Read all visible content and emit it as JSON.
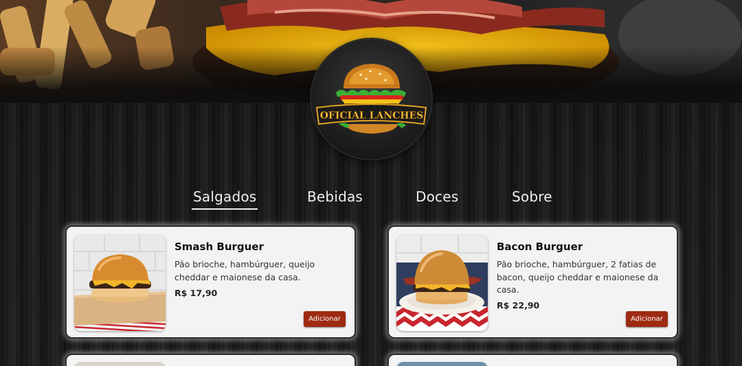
{
  "brand": {
    "logo_text": "OFICIAL LANCHES",
    "logo_icon": "burger-logo-icon"
  },
  "nav": {
    "tabs": [
      {
        "label": "Salgados",
        "active": true
      },
      {
        "label": "Bebidas",
        "active": false
      },
      {
        "label": "Doces",
        "active": false
      },
      {
        "label": "Sobre",
        "active": false
      }
    ]
  },
  "products": [
    {
      "name": "Smash Burguer",
      "description": "Pão brioche, hambúrguer, queijo cheddar e maionese da casa.",
      "price": "R$ 17,90",
      "button": "Adicionar",
      "image_icon": "smash-burger-photo"
    },
    {
      "name": "Bacon Burguer",
      "description": "Pão brioche, hambúrguer, 2 fatias de bacon, queijo cheddar e maionese da casa.",
      "price": "R$ 22,90",
      "button": "Adicionar",
      "image_icon": "bacon-burger-photo"
    }
  ],
  "colors": {
    "accent_button": "#9e2a12",
    "card_bg": "#f3f3f3",
    "page_bg": "#1a1a1a"
  }
}
